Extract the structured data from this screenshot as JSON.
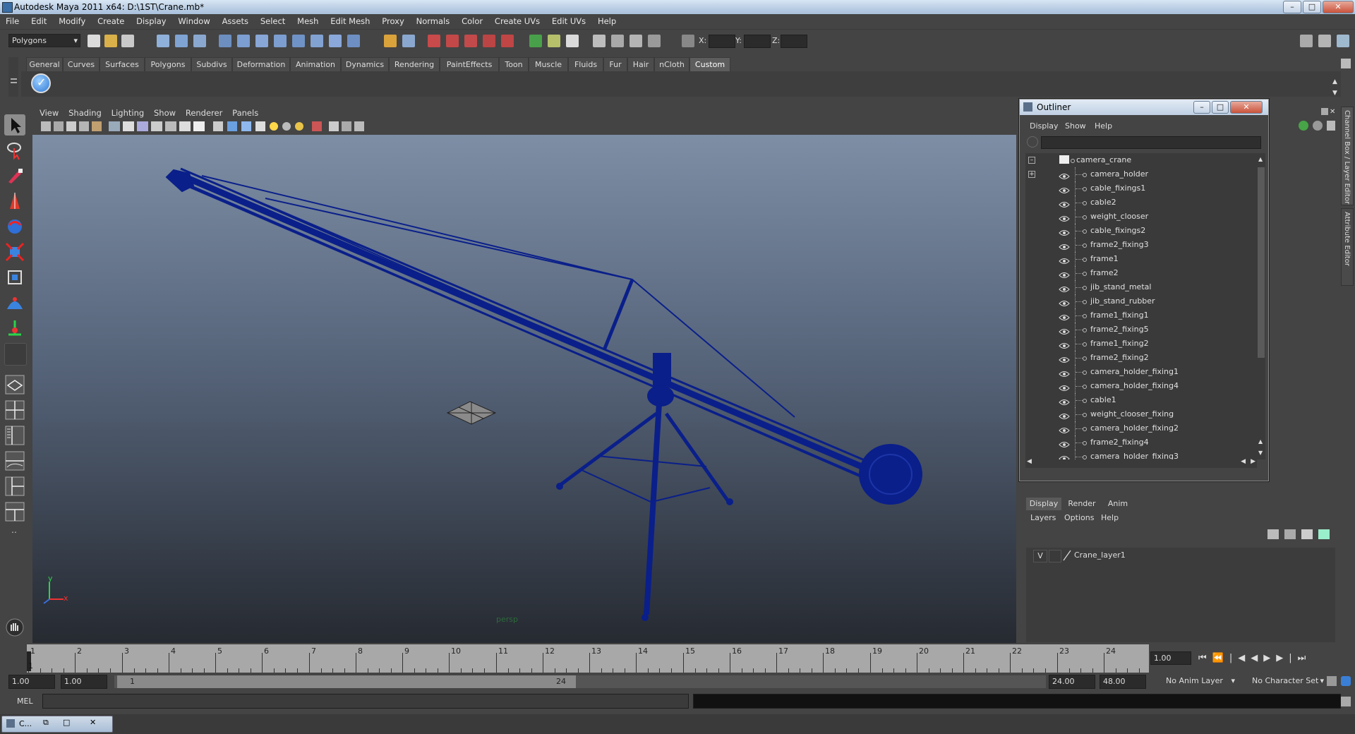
{
  "window": {
    "title": "Autodesk Maya 2011 x64: D:\\1ST\\Crane.mb*",
    "min": "–",
    "max": "□",
    "close": "✕"
  },
  "menubar": [
    "File",
    "Edit",
    "Modify",
    "Create",
    "Display",
    "Window",
    "Assets",
    "Select",
    "Mesh",
    "Edit Mesh",
    "Proxy",
    "Normals",
    "Color",
    "Create UVs",
    "Edit UVs",
    "Help"
  ],
  "statusline": {
    "mode": "Polygons",
    "x_label": "X:",
    "y_label": "Y:",
    "z_label": "Z:"
  },
  "shelf": {
    "tabs": [
      "General",
      "Curves",
      "Surfaces",
      "Polygons",
      "Subdivs",
      "Deformation",
      "Animation",
      "Dynamics",
      "Rendering",
      "PaintEffects",
      "Toon",
      "Muscle",
      "Fluids",
      "Fur",
      "Hair",
      "nCloth",
      "Custom"
    ],
    "active_tab": "Custom"
  },
  "viewport": {
    "menu": [
      "View",
      "Shading",
      "Lighting",
      "Show",
      "Renderer",
      "Panels"
    ],
    "camera_label": "persp",
    "axis_y": "y",
    "axis_x": "x",
    "wire_color": "#0a1f8a"
  },
  "outliner": {
    "title": "Outliner",
    "menu": [
      "Display",
      "Show",
      "Help"
    ],
    "root": "camera_crane",
    "items": [
      "camera_holder",
      "cable_fixings1",
      "cable2",
      "weight_clooser",
      "cable_fixings2",
      "frame2_fixing3",
      "frame1",
      "frame2",
      "jib_stand_metal",
      "jib_stand_rubber",
      "frame1_fixing1",
      "frame2_fixing5",
      "frame1_fixing2",
      "frame2_fixing2",
      "camera_holder_fixing1",
      "camera_holder_fixing4",
      "cable1",
      "weight_clooser_fixing",
      "camera_holder_fixing2",
      "frame2_fixing4",
      "camera_holder_fixing3"
    ]
  },
  "channel_box": {
    "side_tab_1": "Channel Box / Layer Editor",
    "side_tab_2": "Attribute Editor"
  },
  "layer_editor": {
    "tabs": [
      "Display",
      "Render",
      "Anim"
    ],
    "active_tab": "Display",
    "menu": [
      "Layers",
      "Options",
      "Help"
    ],
    "layer_visible": "V",
    "layer_name": "Crane_layer1"
  },
  "timeslider": {
    "frames": [
      "1",
      "2",
      "3",
      "4",
      "5",
      "6",
      "7",
      "8",
      "9",
      "10",
      "11",
      "12",
      "13",
      "14",
      "15",
      "16",
      "17",
      "18",
      "19",
      "20",
      "21",
      "22",
      "23",
      "24"
    ],
    "current_frame_label": "1",
    "current_time": "1.00"
  },
  "range": {
    "start_time": "1.00",
    "playback_start": "1.00",
    "range_start_label": "1",
    "range_end_label": "24",
    "playback_end": "24.00",
    "end_time": "48.00",
    "anim_layer": "No Anim Layer",
    "character_set": "No Character Set"
  },
  "cmdline": {
    "label": "MEL"
  },
  "taskbar": {
    "item": "C..."
  }
}
